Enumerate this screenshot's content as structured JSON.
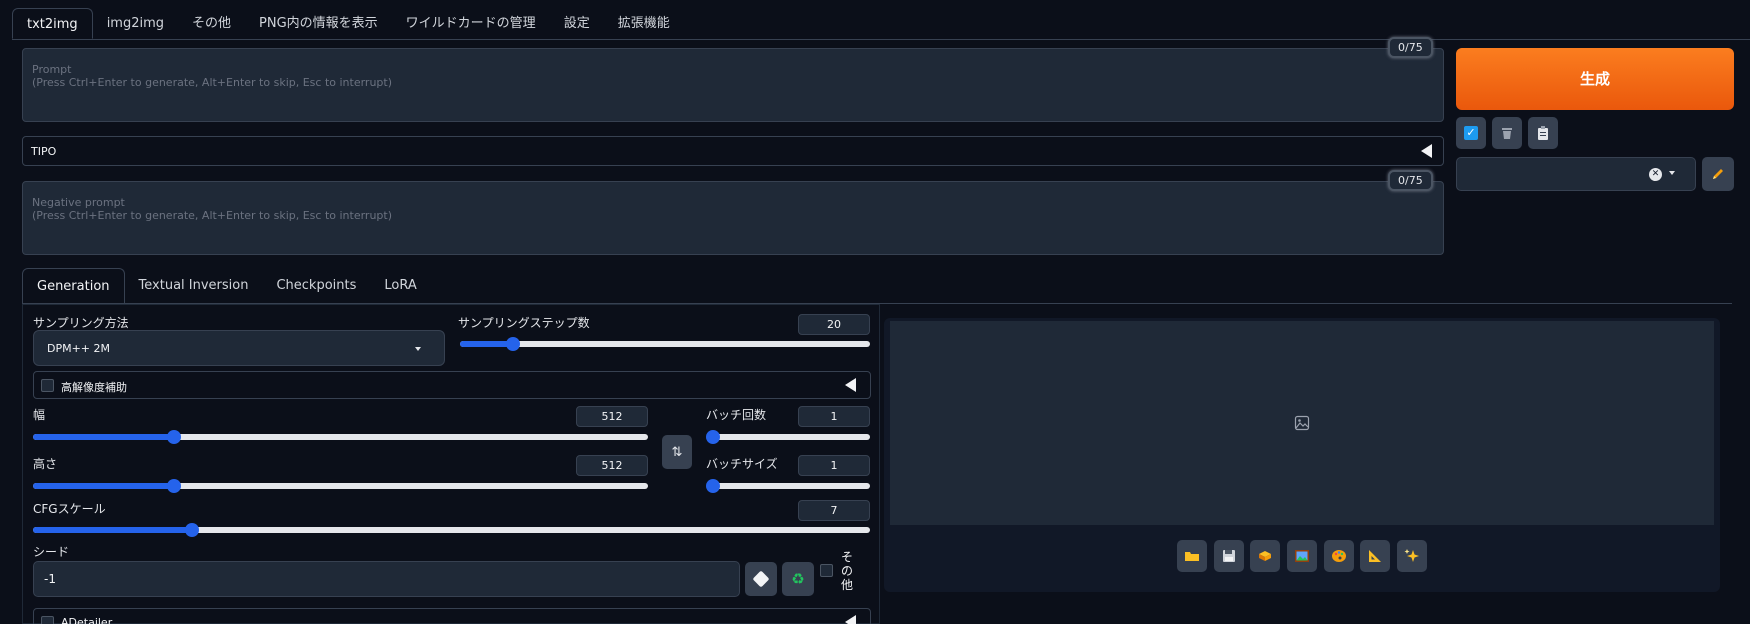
{
  "top_tabs": [
    {
      "label": "txt2img",
      "active": true
    },
    {
      "label": "img2img"
    },
    {
      "label": "その他"
    },
    {
      "label": "PNG内の情報を表示"
    },
    {
      "label": "ワイルドカードの管理"
    },
    {
      "label": "設定"
    },
    {
      "label": "拡張機能"
    }
  ],
  "prompt": {
    "placeholder": "Prompt\n(Press Ctrl+Enter to generate, Alt+Enter to skip, Esc to interrupt)",
    "counter": "0/75"
  },
  "tipo": {
    "label": "TIPO"
  },
  "negative_prompt": {
    "placeholder": "Negative prompt\n(Press Ctrl+Enter to generate, Alt+Enter to skip, Esc to interrupt)",
    "counter": "0/75"
  },
  "generate": {
    "label": "生成",
    "color": "#f97316"
  },
  "sub_tabs": [
    {
      "label": "Generation",
      "active": true
    },
    {
      "label": "Textual Inversion"
    },
    {
      "label": "Checkpoints"
    },
    {
      "label": "LoRA"
    }
  ],
  "generation": {
    "sampler": {
      "label": "サンプリング方法",
      "value": "DPM++ 2M"
    },
    "steps": {
      "label": "サンプリングステップ数",
      "value": "20",
      "fraction": 0.13
    },
    "hires": {
      "label": "高解像度補助"
    },
    "width": {
      "label": "幅",
      "value": "512",
      "fraction": 0.23
    },
    "height": {
      "label": "高さ",
      "value": "512",
      "fraction": 0.23
    },
    "batch_count": {
      "label": "バッチ回数",
      "value": "1",
      "fraction": 0.0
    },
    "batch_size": {
      "label": "バッチサイズ",
      "value": "1",
      "fraction": 0.0
    },
    "cfg": {
      "label": "CFGスケール",
      "value": "7",
      "fraction": 0.19
    },
    "seed": {
      "label": "シード",
      "value": "-1"
    },
    "extra": {
      "label_1": "そ",
      "label_2": "の",
      "label_3": "他"
    },
    "adetailer": {
      "label": "ADetailer"
    }
  },
  "accent_color": "#2563eb"
}
